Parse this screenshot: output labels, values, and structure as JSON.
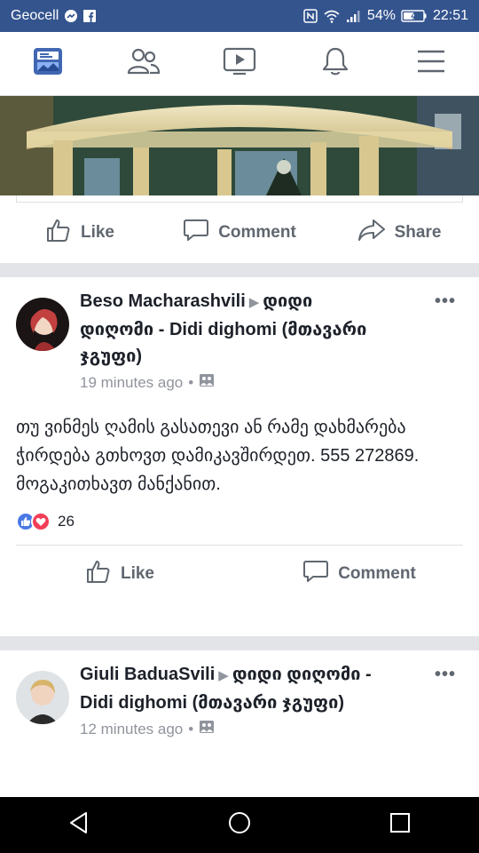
{
  "status_bar": {
    "carrier": "Geocell",
    "battery": "54%",
    "time": "22:51"
  },
  "nav": {
    "tabs": [
      "news-feed-icon",
      "friends-icon",
      "watch-icon",
      "notifications-icon",
      "menu-icon"
    ],
    "active_color": "#4267b2"
  },
  "post0": {
    "actions": {
      "like": "Like",
      "comment": "Comment",
      "share": "Share"
    }
  },
  "post1": {
    "author": "Beso Macharashvili",
    "group": "დიდი დიღომი - Didi dighomi (მთავარი ჯგუფი)",
    "time": "19 minutes ago",
    "body": "თუ ვინმეს ღამის გასათევი ან რამე დახმარება ჭირდება გთხოვთ დამიკავშირდეთ. 555 272869. მოგაკითხავთ მანქანით.",
    "reaction_count": "26",
    "actions": {
      "like": "Like",
      "comment": "Comment"
    }
  },
  "post2": {
    "author": "Giuli BaduaSvili",
    "group": "დიდი დიღომი - Didi dighomi (მთავარი ჯგუფი)",
    "time": "12 minutes ago"
  }
}
